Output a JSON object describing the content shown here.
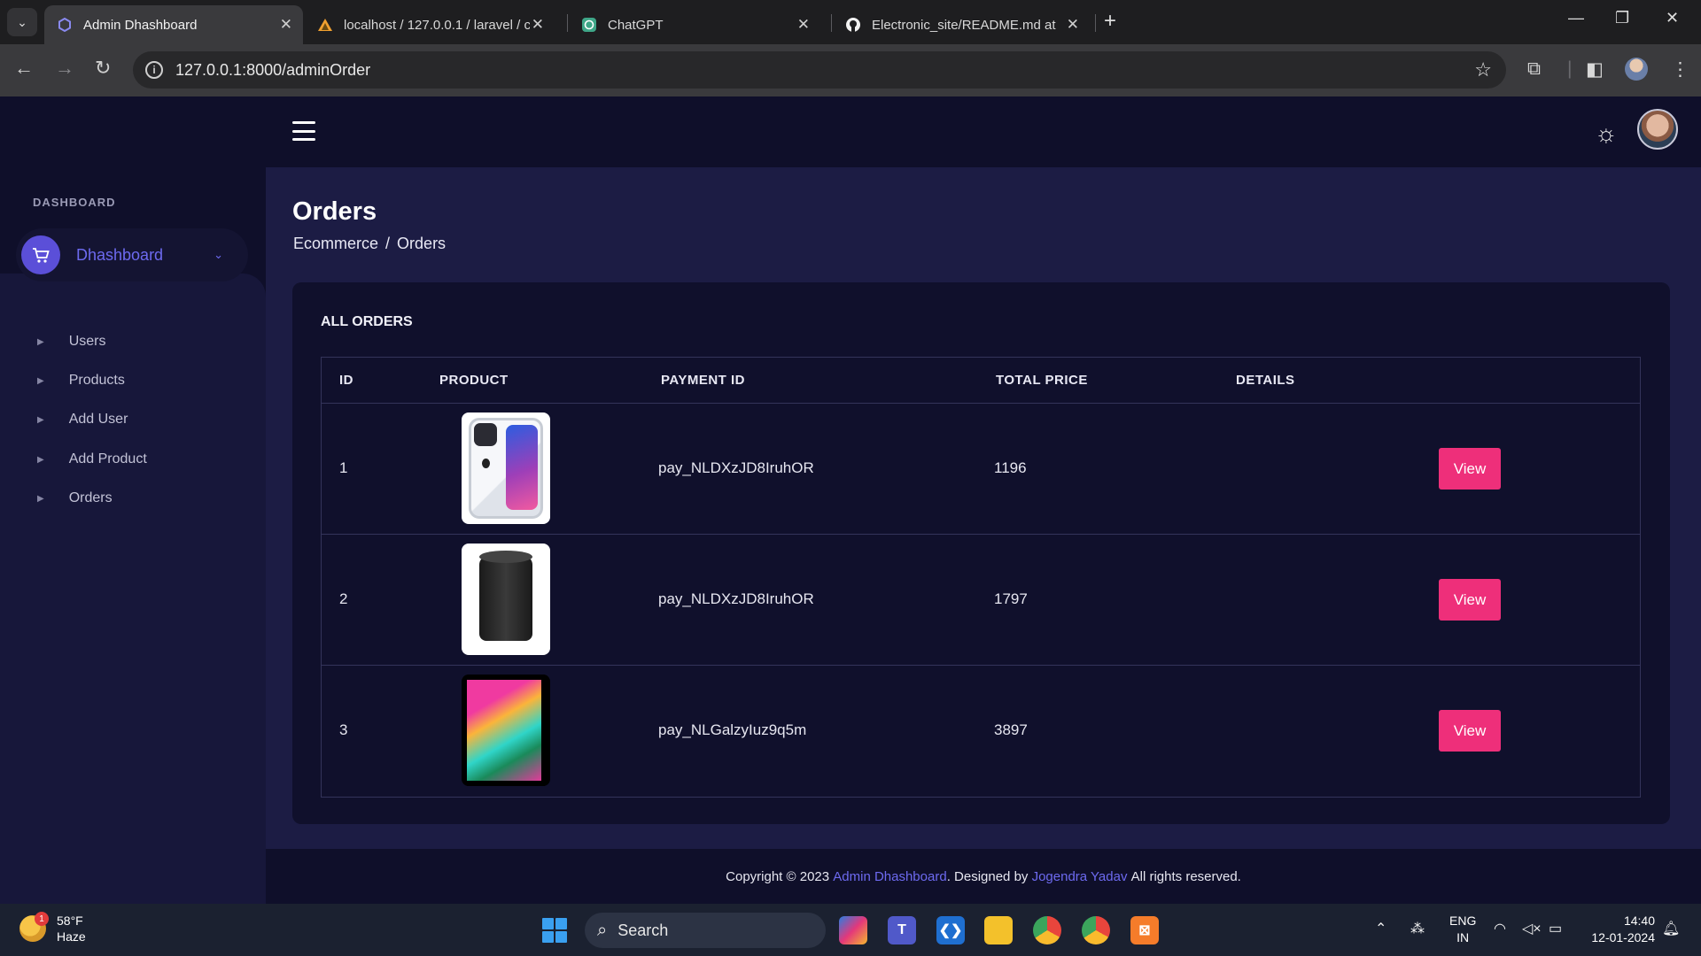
{
  "browser": {
    "tabs": [
      {
        "title": "Admin Dhashboard",
        "active": true
      },
      {
        "title": "localhost / 127.0.0.1 / laravel / c",
        "active": false
      },
      {
        "title": "ChatGPT",
        "active": false
      },
      {
        "title": "Electronic_site/README.md at r",
        "active": false
      }
    ],
    "url": "127.0.0.1:8000/adminOrder"
  },
  "sidebar": {
    "heading": "DASHBOARD",
    "active_label": "Dhashboard",
    "items": [
      {
        "label": "Users"
      },
      {
        "label": "Products"
      },
      {
        "label": "Add User"
      },
      {
        "label": "Add Product"
      },
      {
        "label": "Orders"
      }
    ]
  },
  "page": {
    "title": "Orders",
    "breadcrumb": [
      "Ecommerce",
      "Orders"
    ]
  },
  "orders": {
    "card_title": "ALL ORDERS",
    "columns": [
      "ID",
      "PRODUCT",
      "PAYMENT ID",
      "TOTAL PRICE",
      "DETAILS"
    ],
    "rows": [
      {
        "id": "1",
        "product_image": "iphone-clear-case",
        "payment_id": "pay_NLDXzJD8IruhOR",
        "total_price": "1196",
        "action": "View"
      },
      {
        "id": "2",
        "product_image": "black-speaker",
        "payment_id": "pay_NLDXzJD8IruhOR",
        "total_price": "1797",
        "action": "View"
      },
      {
        "id": "3",
        "product_image": "tablet",
        "payment_id": "pay_NLGalzyIuz9q5m",
        "total_price": "3897",
        "action": "View"
      }
    ]
  },
  "footer": {
    "prefix": "Copyright © 2023 ",
    "brand": "Admin Dhashboard",
    "middle": ". Designed by ",
    "author": "Jogendra Yadav",
    "suffix": " All rights reserved."
  },
  "taskbar": {
    "weather_temp": "58°F",
    "weather_desc": "Haze",
    "weather_badge": "1",
    "search_label": "Search",
    "lang_top": "ENG",
    "lang_bottom": "IN",
    "time": "14:40",
    "date": "12-01-2024"
  },
  "colors": {
    "accent": "#6d6af0",
    "view_button": "#ee2f7a",
    "card_bg": "#10102c"
  }
}
